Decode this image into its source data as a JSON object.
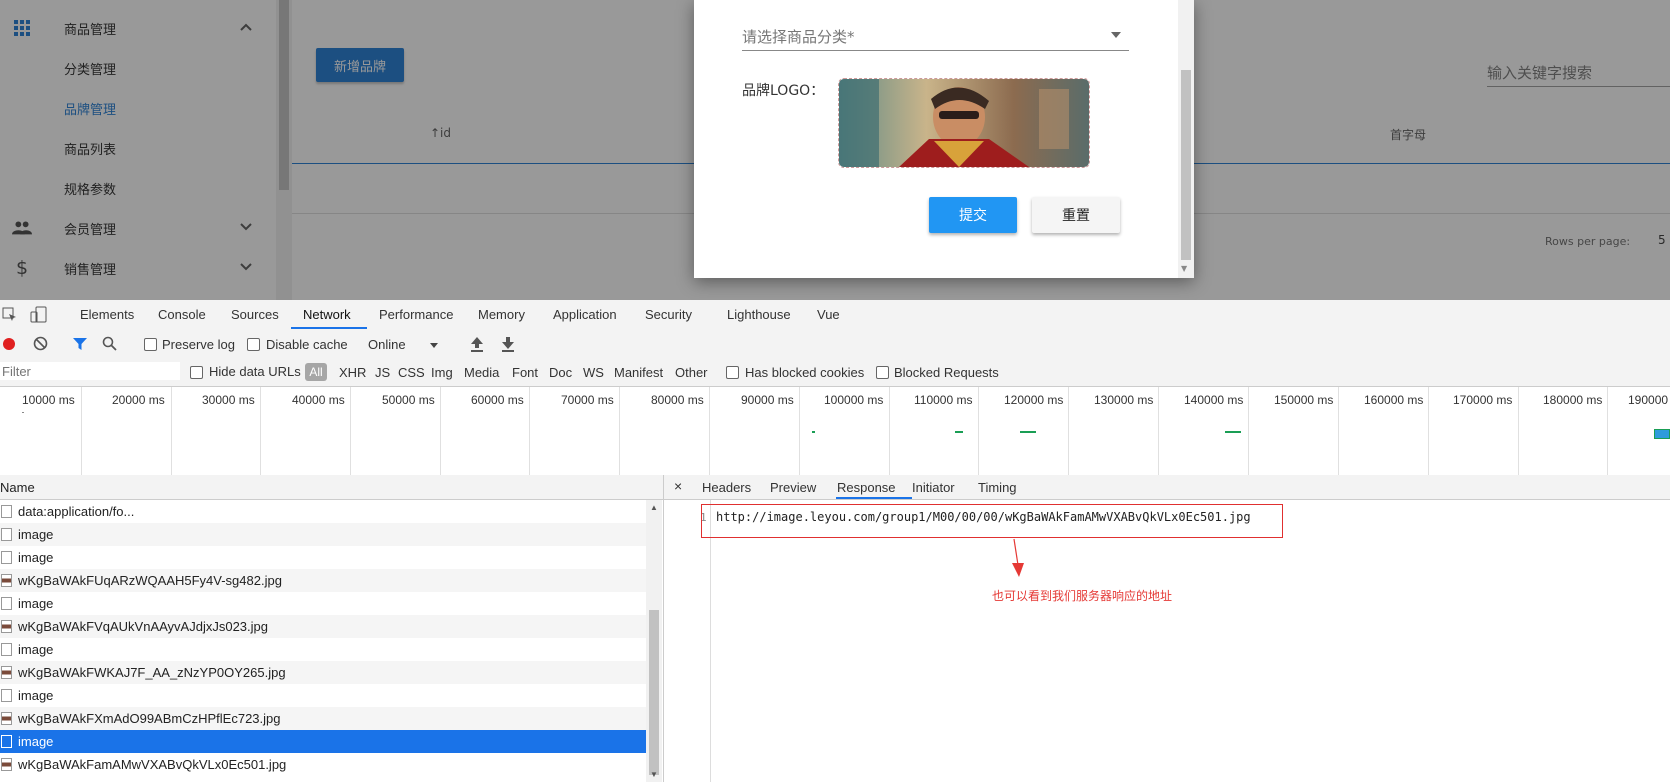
{
  "sidebar": {
    "section_goods": "商品管理",
    "sub_items": [
      "分类管理",
      "品牌管理",
      "商品列表",
      "规格参数"
    ],
    "section_members": "会员管理",
    "section_sales": "销售管理"
  },
  "main": {
    "add_brand_label": "新增品牌",
    "search_placeholder": "输入关键字搜索",
    "columns": {
      "id": "↑id",
      "first_letter": "首字母"
    },
    "rows_per_page_label": "Rows per page:",
    "rows_per_page_value": "5"
  },
  "dialog": {
    "category_placeholder": "请选择商品分类*",
    "logo_label": "品牌LOGO：",
    "submit_label": "提交",
    "reset_label": "重置"
  },
  "devtools": {
    "tabs": [
      "Elements",
      "Console",
      "Sources",
      "Network",
      "Performance",
      "Memory",
      "Application",
      "Security",
      "Lighthouse",
      "Vue"
    ],
    "active_tab": "Network",
    "toolbar": {
      "preserve_log": "Preserve log",
      "disable_cache": "Disable cache",
      "throttle": "Online"
    },
    "filter": {
      "placeholder": "Filter",
      "hide_data_urls": "Hide data URLs",
      "all": "All",
      "types": [
        "XHR",
        "JS",
        "CSS",
        "Img",
        "Media",
        "Font",
        "Doc",
        "WS",
        "Manifest",
        "Other"
      ],
      "has_blocked_cookies": "Has blocked cookies",
      "blocked_requests": "Blocked Requests"
    },
    "timeline_labels": [
      "10000 ms",
      "20000 ms",
      "30000 ms",
      "40000 ms",
      "50000 ms",
      "60000 ms",
      "70000 ms",
      "80000 ms",
      "90000 ms",
      "100000 ms",
      "110000 ms",
      "120000 ms",
      "130000 ms",
      "140000 ms",
      "150000 ms",
      "160000 ms",
      "170000 ms",
      "180000 ms",
      "190000"
    ],
    "name_header": "Name",
    "requests": [
      "data:application/fo...",
      "image",
      "image",
      "wKgBaWAkFUqARzWQAAH5Fy4V-sg482.jpg",
      "image",
      "wKgBaWAkFVqAUkVnAAyvAJdjxJs023.jpg",
      "image",
      "wKgBaWAkFWKAJ7F_AA_zNzYP0OY265.jpg",
      "image",
      "wKgBaWAkFXmAdO99ABmCzHPflEc723.jpg",
      "image",
      "wKgBaWAkFamAMwVXABvQkVLx0Ec501.jpg"
    ],
    "selected_request": "image",
    "detail_tabs": [
      "Headers",
      "Preview",
      "Response",
      "Initiator",
      "Timing"
    ],
    "active_detail_tab": "Response",
    "response_line_number": "1",
    "response_body": "http://image.leyou.com/group1/M00/00/00/wKgBaWAkFamAMwVXABvQkVLx0Ec501.jpg",
    "annotation": "也可以看到我们服务器响应的地址"
  },
  "colors": {
    "primary": "#1976d2",
    "submit": "#2196f3",
    "devtools_accent": "#1a73e8",
    "annotation": "#e53935"
  }
}
